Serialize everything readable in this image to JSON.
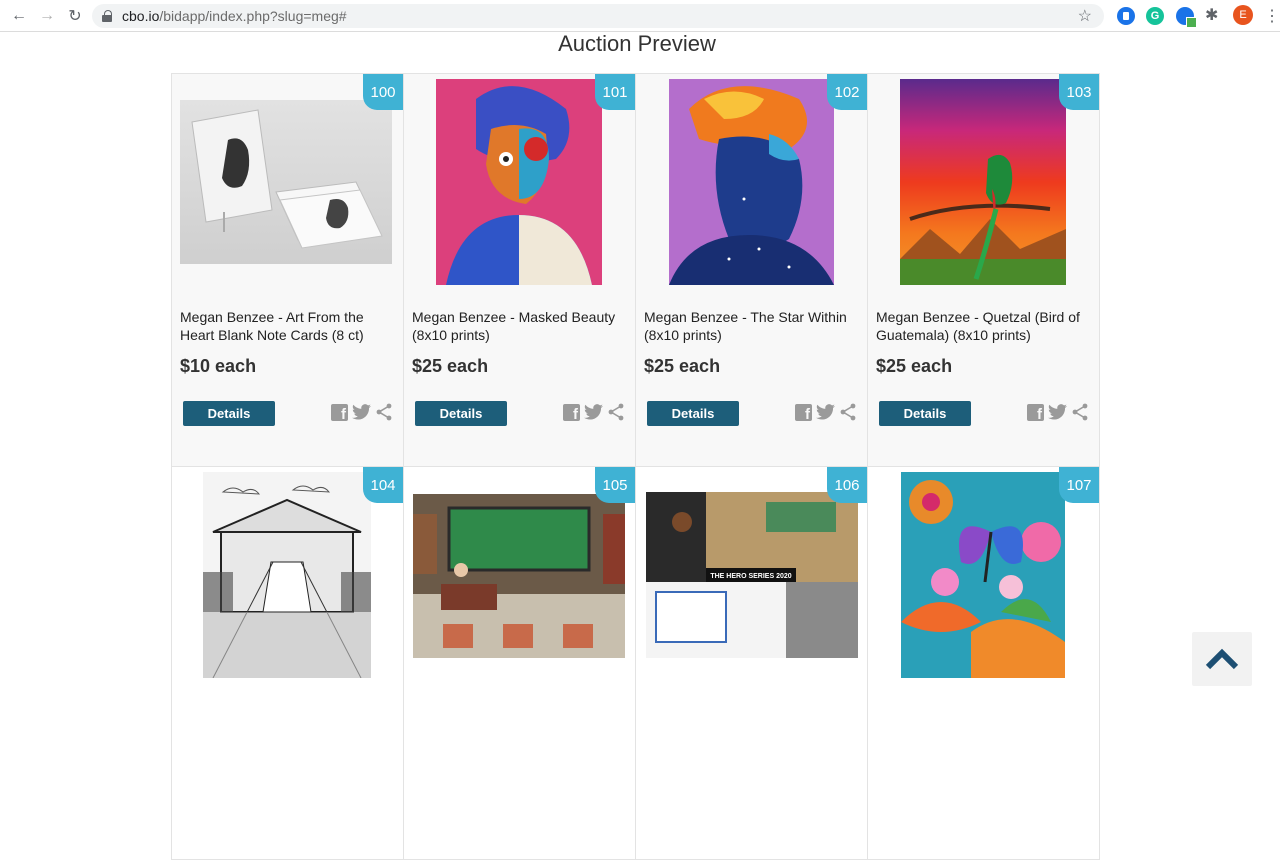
{
  "browser": {
    "url_domain": "cbo.io",
    "url_path": "/bidapp/index.php?slug=meg#",
    "profile_initial": "E",
    "back_icon": "←",
    "forward_icon": "→",
    "reload_icon": "↻",
    "star_icon": "☆",
    "extensions_icon": "✱",
    "menu_icon": "⋮"
  },
  "page": {
    "title": "Auction Preview"
  },
  "items": [
    {
      "lot": "100",
      "title": "Megan Benzee - Art From the Heart Blank Note Cards (8 ct)",
      "price": "$10 each",
      "details_label": "Details"
    },
    {
      "lot": "101",
      "title": "Megan Benzee - Masked Beauty (8x10 prints)",
      "price": "$25 each",
      "details_label": "Details"
    },
    {
      "lot": "102",
      "title": "Megan Benzee - The Star Within (8x10 prints)",
      "price": "$25 each",
      "details_label": "Details"
    },
    {
      "lot": "103",
      "title": "Megan Benzee - Quetzal (Bird of Guatemala) (8x10 prints)",
      "price": "$25 each",
      "details_label": "Details"
    },
    {
      "lot": "104"
    },
    {
      "lot": "105"
    },
    {
      "lot": "106",
      "image_caption": "THE HERO SERIES 2020"
    },
    {
      "lot": "107"
    }
  ],
  "colors": {
    "lot_badge": "#3fb2d4",
    "details_button": "#1d5e7a",
    "scroll_top_arrow": "#1d4f73"
  }
}
